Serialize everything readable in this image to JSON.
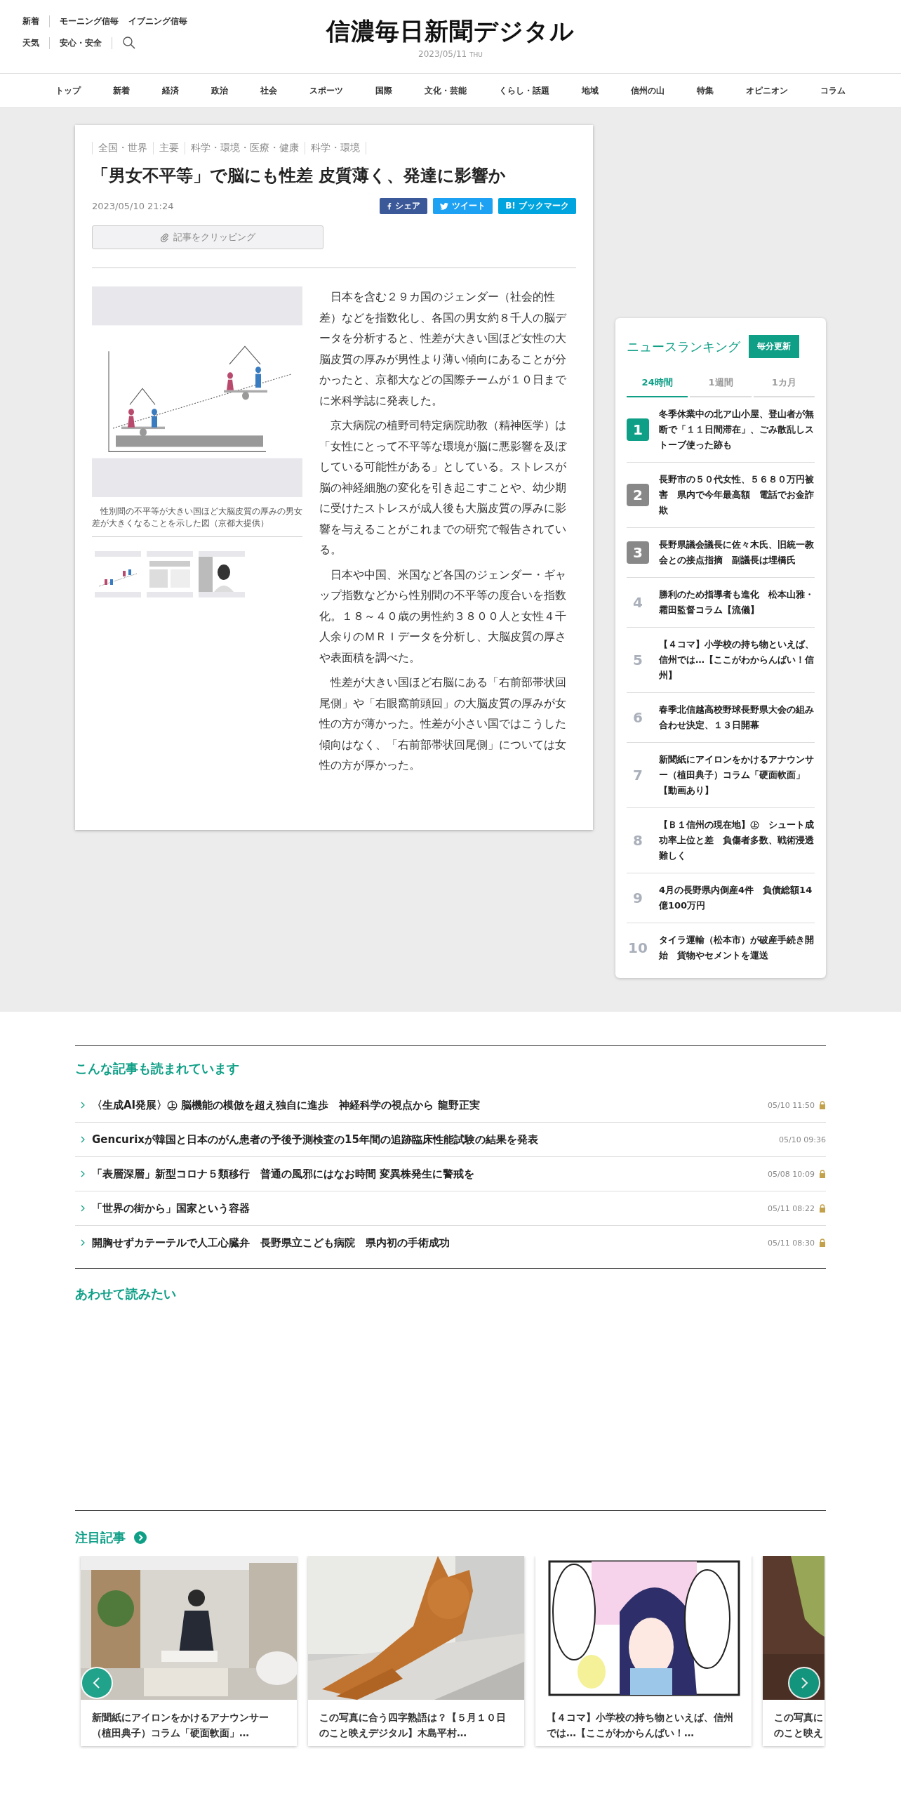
{
  "header": {
    "top_links": [
      "新着",
      "モーニング信毎",
      "イブニング信毎"
    ],
    "bottom_links": [
      "天気",
      "安心・安全"
    ],
    "logo": "信濃毎日新聞デジタル",
    "date": "2023/05/11",
    "weekday": "THU"
  },
  "nav": [
    "トップ",
    "新着",
    "経済",
    "政治",
    "社会",
    "スポーツ",
    "国際",
    "文化・芸能",
    "くらし・話題",
    "地域",
    "信州の山",
    "特集",
    "オピニオン",
    "コラム"
  ],
  "article": {
    "categories": [
      "全国・世界",
      "主要",
      "科学・環境・医療・健康",
      "科学・環境"
    ],
    "title": "「男女不平等」で脳にも性差 皮質薄く、発達に影響か",
    "date": "2023/05/10 21:24",
    "share": [
      {
        "kind": "facebook",
        "label": "シェア"
      },
      {
        "kind": "twitter",
        "label": "ツイート"
      },
      {
        "kind": "hatena",
        "label": "B! ブックマーク"
      }
    ],
    "clip_button": "記事をクリッピング",
    "caption": "性別間の不平等が大きい国ほど大脳皮質の厚みの男女差が大きくなることを示した図（京都大提供）",
    "thumbnails": [
      {
        "kind": "diagram"
      },
      {
        "kind": "table"
      },
      {
        "kind": "portrait"
      }
    ],
    "paragraphs": [
      "日本を含む２９カ国のジェンダー（社会的性差）などを指数化し、各国の男女約８千人の脳データを分析すると、性差が大きい国ほど女性の大脳皮質の厚みが男性より薄い傾向にあることが分かったと、京都大などの国際チームが１０日までに米科学誌に発表した。",
      "京大病院の植野司特定病院助教（精神医学）は「女性にとって不平等な環境が脳に悪影響を及ぼしている可能性がある」としている。ストレスが脳の神経細胞の変化を引き起こすことや、幼少期に受けたストレスが成人後も大脳皮質の厚みに影響を与えることがこれまでの研究で報告されている。",
      "日本や中国、米国など各国のジェンダー・ギャップ指数などから性別間の不平等の度合いを指数化。１８～４０歳の男性約３８００人と女性４千人余りのＭＲＩデータを分析し、大脳皮質の厚さや表面積を調べた。",
      "性差が大きい国ほど右脳にある「右前部帯状回尾側」や「右眼窩前頭回」の大脳皮質の厚みが女性の方が薄かった。性差が小さい国ではこうした傾向はなく、「右前部帯状回尾側」については女性の方が厚かった。"
    ]
  },
  "ranking": {
    "title": "ニュースランキング",
    "update_button": "毎分更新",
    "tabs": [
      {
        "label": "24時間",
        "selected": true
      },
      {
        "label": "1週間",
        "selected": false
      },
      {
        "label": "1カ月",
        "selected": false
      }
    ],
    "items": [
      {
        "rank": "1",
        "kind": "top",
        "title": "冬季休業中の北ア山小屋、登山者が無断で「１１日間滞在」、ごみ散乱しストーブ使った跡も"
      },
      {
        "rank": "2",
        "kind": "high",
        "title": "長野市の５０代女性、５６８０万円被害　県内で今年最高額　電話でお金詐欺"
      },
      {
        "rank": "3",
        "kind": "high",
        "title": "長野県議会議長に佐々木氏、旧統一教会との接点指摘　副議長は埋橋氏"
      },
      {
        "rank": "4",
        "kind": "plain",
        "title": "勝利のため指導者も進化　松本山雅・霜田監督コラム【流儀】"
      },
      {
        "rank": "5",
        "kind": "plain",
        "title": "【４コマ】小学校の持ち物といえば、信州では…【ここがわからんばい！信州】"
      },
      {
        "rank": "6",
        "kind": "plain",
        "title": "春季北信越高校野球長野県大会の組み合わせ決定、１３日開幕"
      },
      {
        "rank": "7",
        "kind": "plain",
        "title": "新聞紙にアイロンをかけるアナウンサー（植田典子）コラム「硬面軟面」【動画あり】"
      },
      {
        "rank": "8",
        "kind": "plain",
        "title": "【Ｂ１信州の現在地】㊤　シュート成功率上位と差　負傷者多数、戦術浸透難しく"
      },
      {
        "rank": "9",
        "kind": "plain",
        "title": "4月の長野県内倒産4件　負債総額14億100万円"
      },
      {
        "rank": "10",
        "kind": "plain",
        "title": "タイラ運輸（松本市）が破産手続き開始　貨物やセメントを運送"
      }
    ]
  },
  "popular": {
    "title": "こんな記事も読まれています",
    "items": [
      {
        "title": "〈生成AI発展〉㊤ 脳機能の模倣を超え独自に進歩　神経科学の視点から 龍野正実",
        "time": "05/10 11:50",
        "locked": true
      },
      {
        "title": "Gencurixが韓国と日本のがん患者の予後予測検査の15年間の追跡臨床性能試験の結果を発表",
        "time": "05/10 09:36",
        "locked": false
      },
      {
        "title": "「表層深層」新型コロナ５類移行　普通の風邪にはなお時間 変異株発生に警戒を",
        "time": "05/08 10:09",
        "locked": true
      },
      {
        "title": "「世界の街から」国家という容器",
        "time": "05/11 08:22",
        "locked": true
      },
      {
        "title": "開胸せずカテーテルで人工心臓弁　長野県立こども病院　県内初の手術成功",
        "time": "05/11 08:30",
        "locked": true
      }
    ]
  },
  "recommended": {
    "title": "あわせて読みたい"
  },
  "featured": {
    "title": "注目記事",
    "cards": [
      {
        "kind": "office",
        "title": "新聞紙にアイロンをかけるアナウンサー（植田典子）コラム「硬面軟面」…"
      },
      {
        "kind": "cat",
        "title": "この写真に合う四字熟語は？【５月１０日のこと映えデジタル】木島平村…"
      },
      {
        "kind": "comic",
        "title": "【４コマ】小学校の持ち物といえば、信州では…【ここがわからんばい！…"
      },
      {
        "kind": "green",
        "title_lines": [
          "この写真に",
          "のこと映え"
        ]
      }
    ]
  }
}
